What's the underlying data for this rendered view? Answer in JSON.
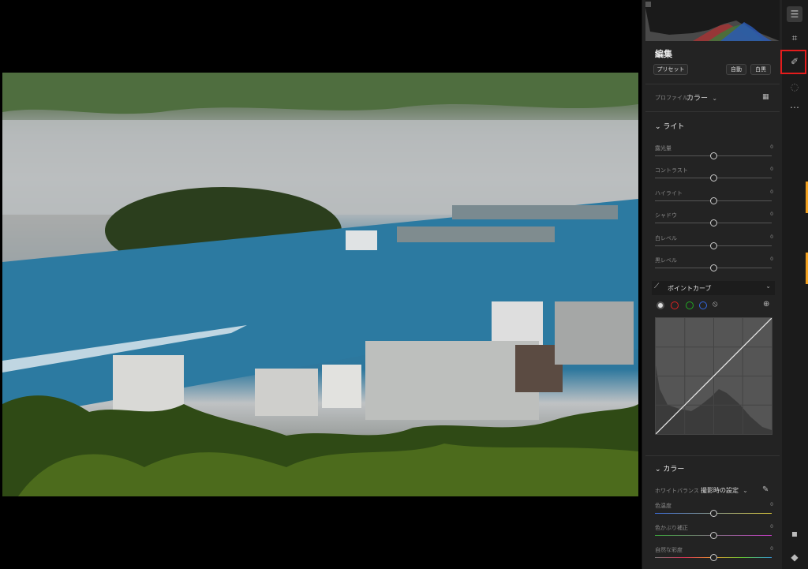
{
  "panel": {
    "title": "編集",
    "preset_label": "プリセット",
    "auto_label": "自動",
    "bw_label": "白黒",
    "profile_label": "プロファイル",
    "profile_value": "カラー",
    "light_section": "ライト",
    "light_sliders": [
      {
        "label": "露光量",
        "value": "0"
      },
      {
        "label": "コントラスト",
        "value": "0"
      },
      {
        "label": "ハイライト",
        "value": "0"
      },
      {
        "label": "シャドウ",
        "value": "0"
      },
      {
        "label": "白レベル",
        "value": "0"
      },
      {
        "label": "黒レベル",
        "value": "0"
      }
    ],
    "point_curve_label": "ポイントカーブ",
    "color_section": "カラー",
    "white_balance_label": "ホワイトバランス",
    "white_balance_value": "撮影時の設定",
    "color_sliders": [
      {
        "label": "色温度",
        "value": "0"
      },
      {
        "label": "色かぶり補正",
        "value": "0"
      },
      {
        "label": "自然な彩度",
        "value": "0"
      }
    ]
  },
  "colors": {
    "accent_highlight": "#e41c1c",
    "panel_bg": "#232323"
  }
}
